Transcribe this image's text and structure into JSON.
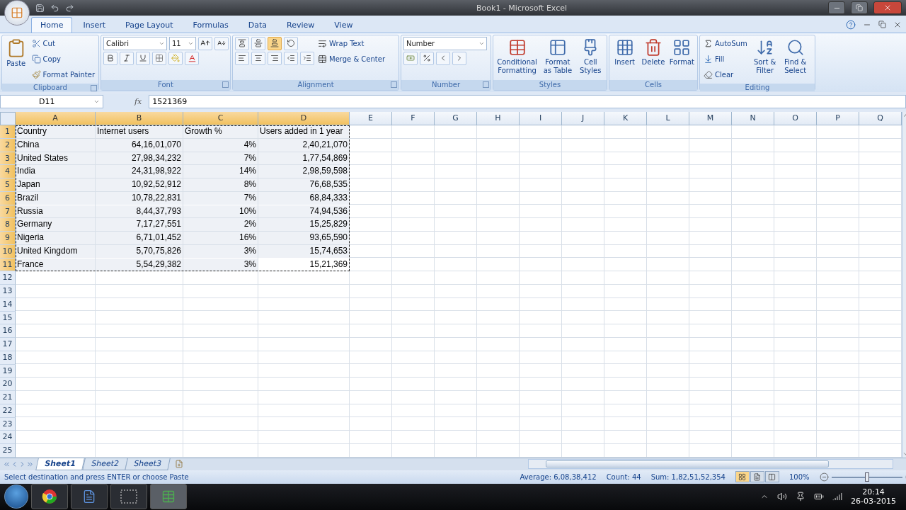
{
  "window": {
    "title": "Book1 - Microsoft Excel"
  },
  "ribbon_tabs": [
    {
      "label": "Home",
      "selected": true
    },
    {
      "label": "Insert",
      "selected": false
    },
    {
      "label": "Page Layout",
      "selected": false
    },
    {
      "label": "Formulas",
      "selected": false
    },
    {
      "label": "Data",
      "selected": false
    },
    {
      "label": "Review",
      "selected": false
    },
    {
      "label": "View",
      "selected": false
    }
  ],
  "ribbon": {
    "clipboard": {
      "title": "Clipboard",
      "paste": "Paste",
      "cut": "Cut",
      "copy": "Copy",
      "format_painter": "Format Painter"
    },
    "font": {
      "title": "Font",
      "font_name": "Calibri",
      "font_size": "11"
    },
    "alignment": {
      "title": "Alignment",
      "bottom_align_selected": true,
      "wrap_text": "Wrap Text",
      "merge_center": "Merge & Center"
    },
    "number": {
      "title": "Number",
      "format": "Number"
    },
    "styles": {
      "title": "Styles",
      "conditional_formatting": "Conditional Formatting",
      "format_as_table": "Format as Table",
      "cell_styles": "Cell Styles"
    },
    "cells": {
      "title": "Cells",
      "insert": "Insert",
      "delete": "Delete",
      "format": "Format"
    },
    "editing": {
      "title": "Editing",
      "autosum": "AutoSum",
      "fill": "Fill",
      "clear": "Clear",
      "sort_filter": "Sort & Filter",
      "find_select": "Find & Select"
    }
  },
  "formula_bar": {
    "name_box": "D11",
    "fx_label": "fx",
    "value": "1521369"
  },
  "sheet": {
    "copy_marquee": true,
    "columns": [
      {
        "label": "A",
        "highlighted": true
      },
      {
        "label": "B",
        "highlighted": true
      },
      {
        "label": "C",
        "highlighted": true
      },
      {
        "label": "D",
        "highlighted": true
      },
      {
        "label": "E",
        "highlighted": false
      },
      {
        "label": "F",
        "highlighted": false
      },
      {
        "label": "G",
        "highlighted": false
      },
      {
        "label": "H",
        "highlighted": false
      },
      {
        "label": "I",
        "highlighted": false
      },
      {
        "label": "J",
        "highlighted": false
      },
      {
        "label": "K",
        "highlighted": false
      },
      {
        "label": "L",
        "highlighted": false
      },
      {
        "label": "M",
        "highlighted": false
      },
      {
        "label": "N",
        "highlighted": false
      },
      {
        "label": "O",
        "highlighted": false
      },
      {
        "label": "P",
        "highlighted": false
      },
      {
        "label": "Q",
        "highlighted": false
      }
    ],
    "rows": [
      {
        "number": "1",
        "highlighted": true,
        "cells": [
          {
            "v": "Country",
            "selected": false
          },
          {
            "v": "Internet users",
            "selected": false
          },
          {
            "v": "Growth %",
            "selected": false
          },
          {
            "v": "Users added in 1 year",
            "selected": false
          }
        ]
      },
      {
        "number": "2",
        "highlighted": true,
        "cells": [
          {
            "v": "China",
            "selected": false
          },
          {
            "v": "64,16,01,070",
            "selected": false
          },
          {
            "v": "4%",
            "selected": false
          },
          {
            "v": "2,40,21,070",
            "selected": false
          }
        ]
      },
      {
        "number": "3",
        "highlighted": true,
        "cells": [
          {
            "v": "United States",
            "selected": false
          },
          {
            "v": "27,98,34,232",
            "selected": false
          },
          {
            "v": "7%",
            "selected": false
          },
          {
            "v": "1,77,54,869",
            "selected": false
          }
        ]
      },
      {
        "number": "4",
        "highlighted": true,
        "cells": [
          {
            "v": "India",
            "selected": false
          },
          {
            "v": "24,31,98,922",
            "selected": false
          },
          {
            "v": "14%",
            "selected": false
          },
          {
            "v": "2,98,59,598",
            "selected": false
          }
        ]
      },
      {
        "number": "5",
        "highlighted": true,
        "cells": [
          {
            "v": "Japan",
            "selected": false
          },
          {
            "v": "10,92,52,912",
            "selected": false
          },
          {
            "v": "8%",
            "selected": false
          },
          {
            "v": "76,68,535",
            "selected": false
          }
        ]
      },
      {
        "number": "6",
        "highlighted": true,
        "cells": [
          {
            "v": "Brazil",
            "selected": false
          },
          {
            "v": "10,78,22,831",
            "selected": false
          },
          {
            "v": "7%",
            "selected": false
          },
          {
            "v": "68,84,333",
            "selected": false
          }
        ]
      },
      {
        "number": "7",
        "highlighted": true,
        "cells": [
          {
            "v": "Russia",
            "selected": false
          },
          {
            "v": "8,44,37,793",
            "selected": false
          },
          {
            "v": "10%",
            "selected": false
          },
          {
            "v": "74,94,536",
            "selected": false
          }
        ]
      },
      {
        "number": "8",
        "highlighted": true,
        "cells": [
          {
            "v": "Germany",
            "selected": false
          },
          {
            "v": "7,17,27,551",
            "selected": false
          },
          {
            "v": "2%",
            "selected": false
          },
          {
            "v": "15,25,829",
            "selected": false
          }
        ]
      },
      {
        "number": "9",
        "highlighted": true,
        "cells": [
          {
            "v": "Nigeria",
            "selected": false
          },
          {
            "v": "6,71,01,452",
            "selected": false
          },
          {
            "v": "16%",
            "selected": false
          },
          {
            "v": "93,65,590",
            "selected": false
          }
        ]
      },
      {
        "number": "10",
        "highlighted": true,
        "cells": [
          {
            "v": "United Kingdom",
            "selected": false
          },
          {
            "v": "5,70,75,826",
            "selected": false
          },
          {
            "v": "3%",
            "selected": false
          },
          {
            "v": "15,74,653",
            "selected": false
          }
        ]
      },
      {
        "number": "11",
        "highlighted": true,
        "cells": [
          {
            "v": "France",
            "selected": false
          },
          {
            "v": "5,54,29,382",
            "selected": false
          },
          {
            "v": "3%",
            "selected": false
          },
          {
            "v": "15,21,369",
            "selected": true
          }
        ]
      },
      {
        "number": "12",
        "highlighted": false
      },
      {
        "number": "13",
        "highlighted": false
      },
      {
        "number": "14",
        "highlighted": false
      },
      {
        "number": "15",
        "highlighted": false
      },
      {
        "number": "16",
        "highlighted": false
      },
      {
        "number": "17",
        "highlighted": false
      },
      {
        "number": "18",
        "highlighted": false
      },
      {
        "number": "19",
        "highlighted": false
      },
      {
        "number": "20",
        "highlighted": false
      },
      {
        "number": "21",
        "highlighted": false
      },
      {
        "number": "22",
        "highlighted": false
      },
      {
        "number": "23",
        "highlighted": false
      },
      {
        "number": "24",
        "highlighted": false
      },
      {
        "number": "25",
        "highlighted": false
      }
    ]
  },
  "sheet_tabs": [
    {
      "label": "Sheet1",
      "selected": true
    },
    {
      "label": "Sheet2",
      "selected": false
    },
    {
      "label": "Sheet3",
      "selected": false
    }
  ],
  "status_bar": {
    "message": "Select destination and press ENTER or choose Paste",
    "average": "Average: 6,08,38,412",
    "count": "Count: 44",
    "sum": "Sum: 1,82,51,52,354",
    "views": [
      {
        "selected": true
      },
      {
        "selected": false
      },
      {
        "selected": false
      }
    ],
    "zoom": "100%",
    "zoom_slider": {
      "level": 0.5
    }
  },
  "taskbar": {
    "time": "20:14",
    "date": "26-03-2015"
  }
}
